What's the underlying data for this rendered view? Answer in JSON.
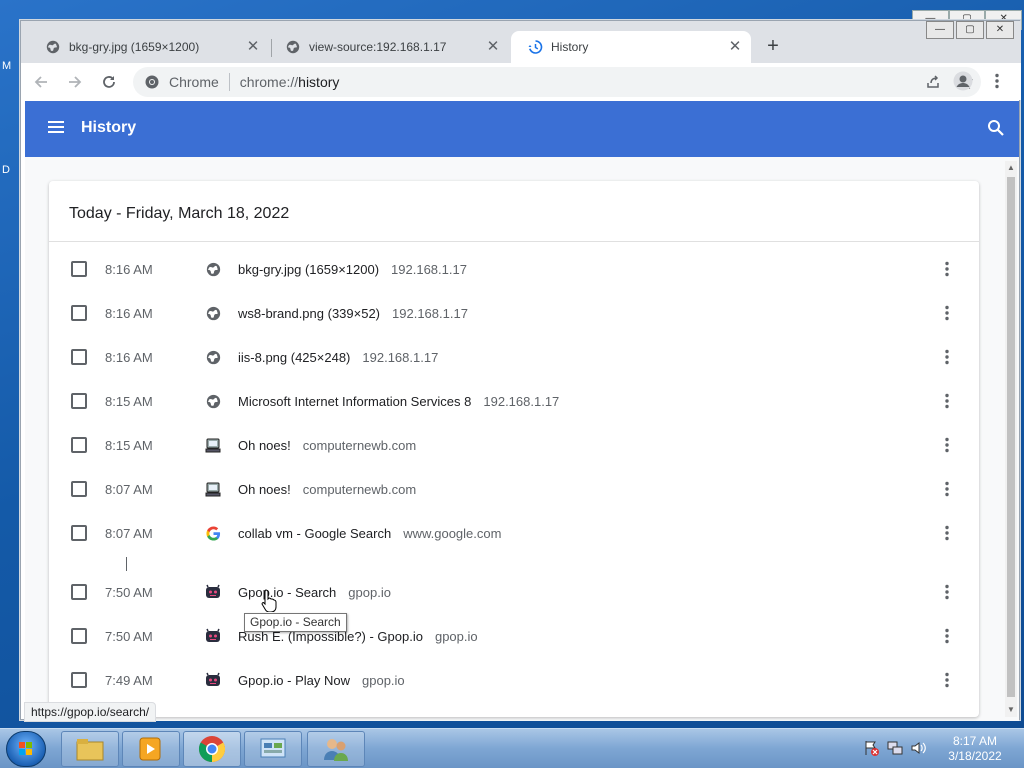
{
  "desktop": {
    "left_text_1": "M",
    "left_text_2": "D"
  },
  "window_controls": {
    "minimize": "—",
    "maximize": "▢",
    "close": "✕"
  },
  "tabs": [
    {
      "title": "bkg-gry.jpg (1659×1200)",
      "icon": "globe-icon"
    },
    {
      "title": "view-source:192.168.1.17",
      "icon": "globe-icon"
    },
    {
      "title": "History",
      "icon": "history-icon",
      "active": true
    }
  ],
  "toolbar": {
    "site_label": "Chrome",
    "url_scheme": "chrome://",
    "url_host": "history"
  },
  "header": {
    "title": "History"
  },
  "history": {
    "date_heading": "Today - Friday, March 18, 2022",
    "entries": [
      {
        "time": "8:16 AM",
        "title": "bkg-gry.jpg (1659×1200)",
        "domain": "192.168.1.17",
        "icon": "globe-icon"
      },
      {
        "time": "8:16 AM",
        "title": "ws8-brand.png (339×52)",
        "domain": "192.168.1.17",
        "icon": "globe-icon"
      },
      {
        "time": "8:16 AM",
        "title": "iis-8.png (425×248)",
        "domain": "192.168.1.17",
        "icon": "globe-icon"
      },
      {
        "time": "8:15 AM",
        "title": "Microsoft Internet Information Services 8",
        "domain": "192.168.1.17",
        "icon": "globe-icon"
      },
      {
        "time": "8:15 AM",
        "title": "Oh noes!",
        "domain": "computernewb.com",
        "icon": "computernewb-icon"
      },
      {
        "time": "8:07 AM",
        "title": "Oh noes!",
        "domain": "computernewb.com",
        "icon": "computernewb-icon"
      },
      {
        "time": "8:07 AM",
        "title": "collab vm - Google Search",
        "domain": "www.google.com",
        "icon": "google-icon"
      },
      {
        "time": "7:50 AM",
        "title": "Gpop.io - Search",
        "domain": "gpop.io",
        "icon": "gpop-icon"
      },
      {
        "time": "7:50 AM",
        "title": "Rush E. (Impossible?) - Gpop.io",
        "domain": "gpop.io",
        "icon": "gpop-icon"
      },
      {
        "time": "7:49 AM",
        "title": "Gpop.io - Play Now",
        "domain": "gpop.io",
        "icon": "gpop-icon"
      }
    ]
  },
  "tooltip": "Gpop.io - Search",
  "status_url": "https://gpop.io/search/",
  "taskbar": {
    "items": [
      "explorer-icon",
      "media-player-icon",
      "chrome-icon",
      "control-panel-icon",
      "users-icon"
    ],
    "clock_time": "8:17 AM",
    "clock_date": "3/18/2022"
  }
}
